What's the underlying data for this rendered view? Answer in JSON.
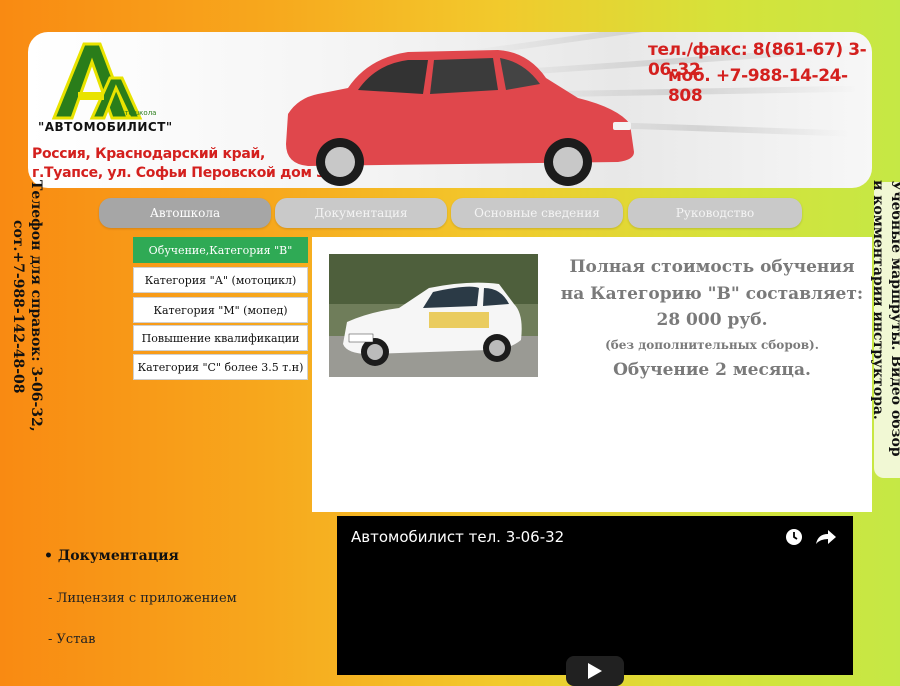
{
  "header": {
    "logo_caption": "\"АВТОМОБИЛИСТ\"",
    "logo_sub": "автошкола",
    "address_line1": "Россия, Краснодарский край,",
    "address_line2": "г.Туапсе, ул. Софьи Перовской дом 3",
    "phone_fax": "тел./факс: 8(861-67) 3-06-32",
    "phone_mobile": "моб. +7-988-14-24-808"
  },
  "nav": {
    "tabs": [
      {
        "label": "Автошкола"
      },
      {
        "label": "Документация"
      },
      {
        "label": "Основные сведения"
      },
      {
        "label": "Руководство"
      }
    ]
  },
  "side_menu": {
    "items": [
      {
        "label": "Обучение,Категория \"В\""
      },
      {
        "label": "Категория \"А\" (мотоцикл)"
      },
      {
        "label": "Категория \"М\" (мопед)"
      },
      {
        "label": "Повышение квалификации"
      },
      {
        "label": "Категория \"С\" более 3.5 т.н)"
      }
    ]
  },
  "content": {
    "price_line1": "Полная стоимость обучения",
    "price_line2": "на Категорию \"В\" составляет:",
    "price_amount": "28 000 руб.",
    "price_note": "(без дополнительных сборов).",
    "duration": "Обучение 2 месяца."
  },
  "left_banner": {
    "line1": "Телефон для справок: 3-06-32,",
    "line2": "сот.+7-988-142-48-08"
  },
  "right_banner": {
    "line1": "Учебные маршруты. Видео обзор",
    "line2": "и комментарии инструктора."
  },
  "documents": {
    "heading": "Документация",
    "links": [
      {
        "label": "- Лицензия с приложением"
      },
      {
        "label": "- Устав"
      }
    ]
  },
  "video": {
    "title": "Автомобилист тел. 3-06-32"
  },
  "colors": {
    "accent_red": "#d4201e",
    "active_menu_green": "#2faa55",
    "logo_green": "#2a7d1a",
    "logo_yellow": "#e9e300"
  }
}
